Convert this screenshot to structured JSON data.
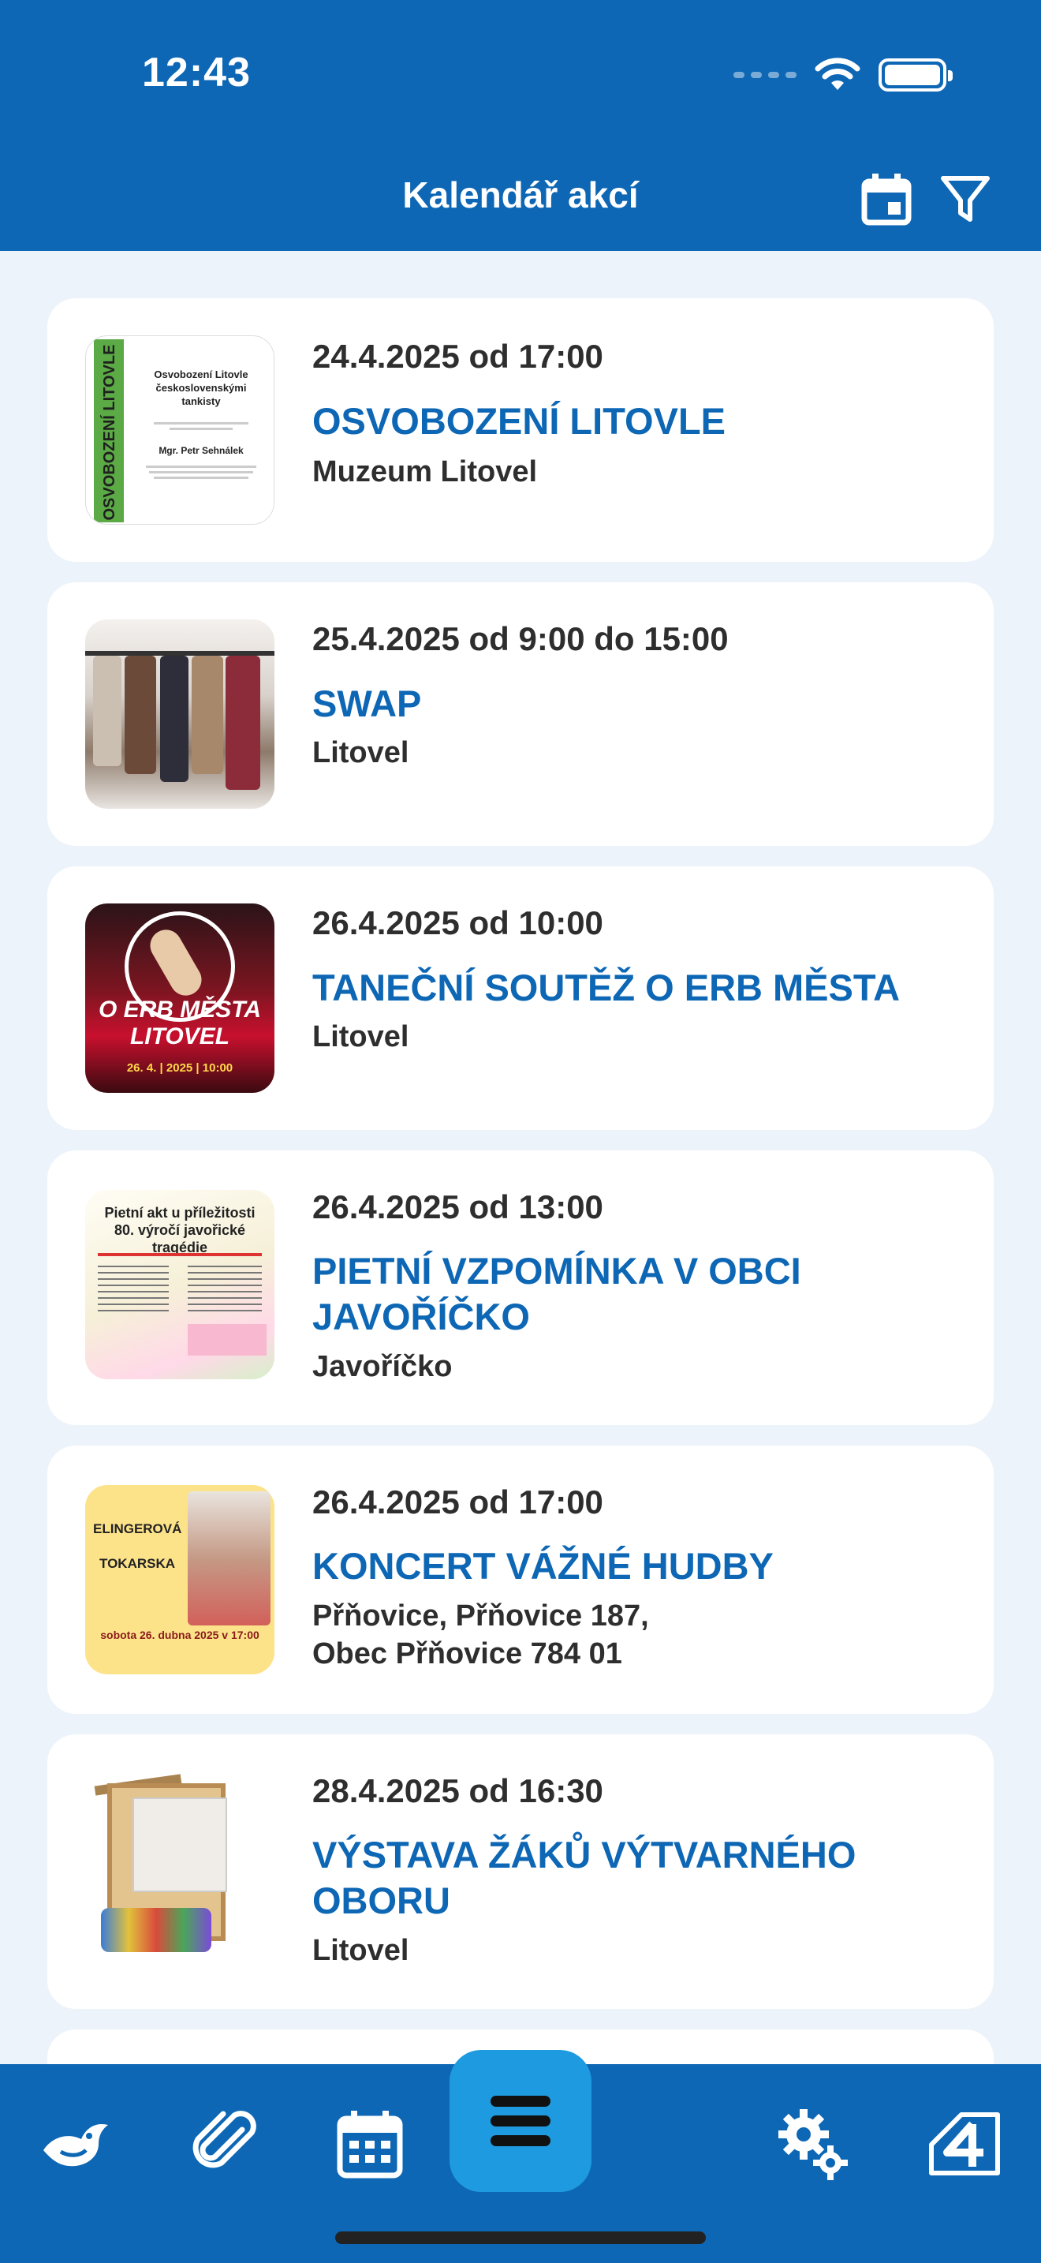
{
  "status": {
    "time": "12:43"
  },
  "header": {
    "title": "Kalendář akcí"
  },
  "events": [
    {
      "date": "24.4.2025 od 17:00",
      "title": "OSVOBOZENÍ LITOVLE",
      "place": "Muzeum Litovel",
      "thumb": {
        "side_text": "OSVOBOZENÍ LITOVLE",
        "lines": [
          "Osvobození Litovle",
          "československými",
          "tankisty",
          "Mgr. Petr Sehnálek"
        ]
      }
    },
    {
      "date": "25.4.2025 od 9:00 do 15:00",
      "title": "SWAP",
      "place": "Litovel"
    },
    {
      "date": "26.4.2025 od 10:00",
      "title": "TANEČNÍ SOUTĚŽ O ERB MĚSTA",
      "place": "Litovel",
      "thumb": {
        "line1": "O ERB MĚSTA",
        "line2": "LITOVEL",
        "line3": "26. 4. | 2025 | 10:00"
      }
    },
    {
      "date": "26.4.2025 od 13:00",
      "title": "PIETNÍ VZPOMÍNKA V OBCI JAVOŘÍČKO",
      "place": "Javoříčko",
      "thumb": {
        "line1": "Pietní akt u příležitosti",
        "line2": "80. výročí javořické tragédie"
      }
    },
    {
      "date": "26.4.2025 od 17:00",
      "title": "KONCERT VÁŽNÉ HUDBY",
      "place": "Přňovice, Přňovice 187, Obec Přňovice 784  01",
      "thumb": {
        "line1": "ELINGEROVÁ",
        "line2": "TOKARSKA",
        "line3": "sobota 26. dubna 2025 v 17:00"
      }
    },
    {
      "date": "28.4.2025 od 16:30",
      "title": "VÝSTAVA ŽÁKŮ VÝTVARNÉHO OBORU",
      "place": "Litovel"
    }
  ],
  "tabbar": {
    "items": [
      "bird-logo-icon",
      "paperclip-icon",
      "calendar-icon",
      "menu-icon",
      "settings-icon",
      "four-logo-icon"
    ]
  },
  "colors": {
    "primary": "#0D67B5",
    "accent": "#1E9BE0",
    "background": "#ECF3FA"
  }
}
